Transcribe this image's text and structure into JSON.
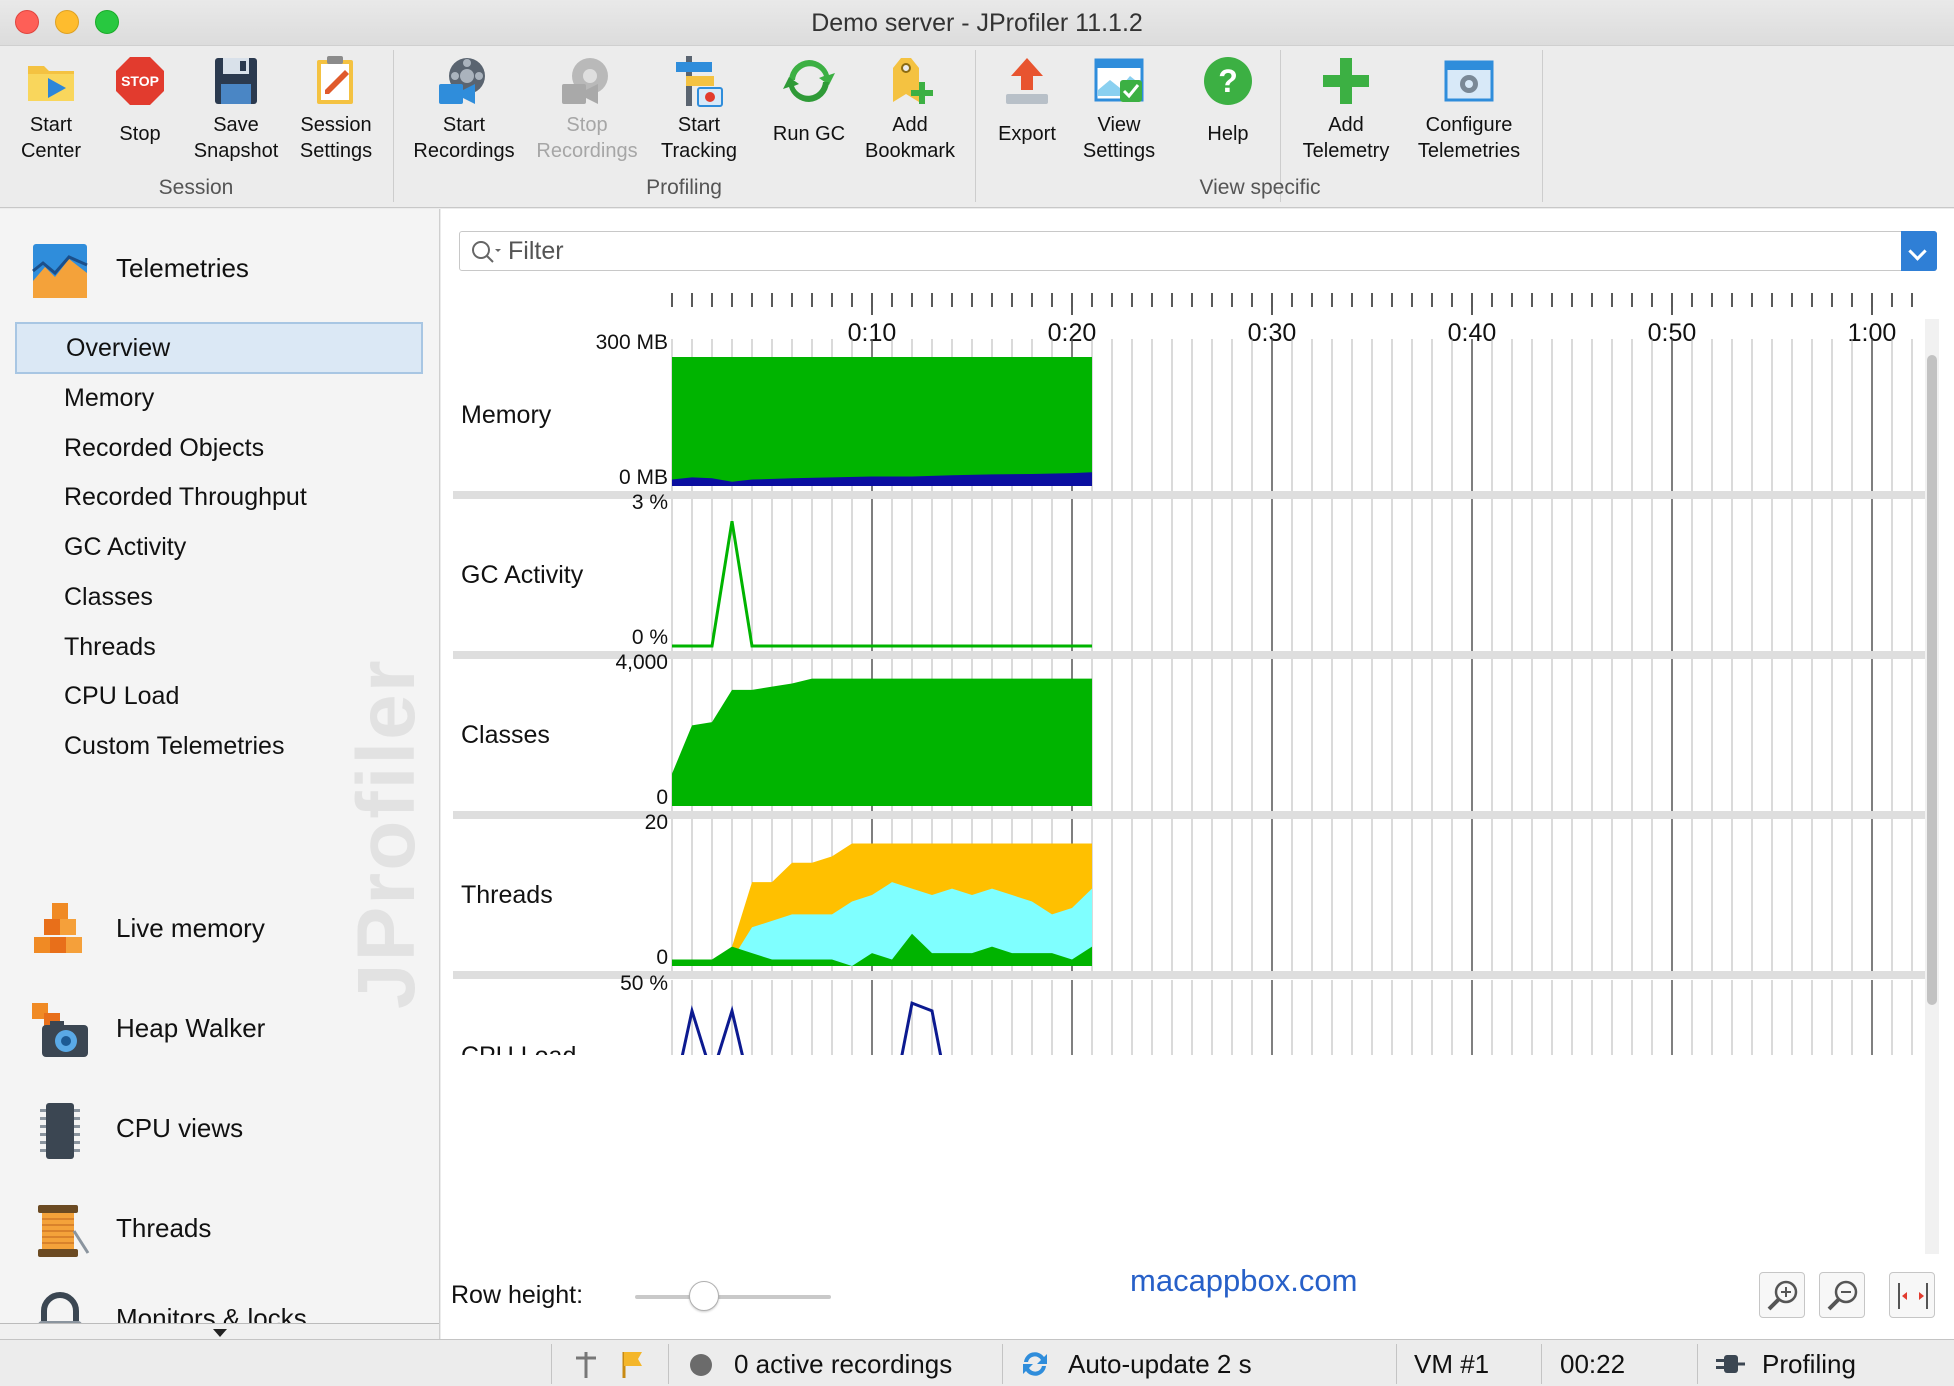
{
  "window": {
    "title": "Demo server - JProfiler 11.1.2"
  },
  "toolbar": {
    "groups": {
      "session": "Session",
      "profiling": "Profiling",
      "view": "View specific"
    },
    "buttons": {
      "start_center": {
        "l1": "Start",
        "l2": "Center"
      },
      "stop": {
        "l1": "Stop"
      },
      "save_snapshot": {
        "l1": "Save",
        "l2": "Snapshot"
      },
      "session_settings": {
        "l1": "Session",
        "l2": "Settings"
      },
      "start_recordings": {
        "l1": "Start",
        "l2": "Recordings"
      },
      "stop_recordings": {
        "l1": "Stop",
        "l2": "Recordings"
      },
      "start_tracking": {
        "l1": "Start",
        "l2": "Tracking"
      },
      "run_gc": {
        "l1": "Run GC"
      },
      "add_bookmark": {
        "l1": "Add",
        "l2": "Bookmark"
      },
      "export": {
        "l1": "Export"
      },
      "view_settings": {
        "l1": "View",
        "l2": "Settings"
      },
      "help": {
        "l1": "Help"
      },
      "add_telemetry": {
        "l1": "Add",
        "l2": "Telemetry"
      },
      "configure_telemetries": {
        "l1": "Configure",
        "l2": "Telemetries"
      }
    },
    "stop_icon_text": "STOP"
  },
  "sidebar": {
    "telemetries": "Telemetries",
    "items": [
      "Overview",
      "Memory",
      "Recorded Objects",
      "Recorded Throughput",
      "GC Activity",
      "Classes",
      "Threads",
      "CPU Load",
      "Custom Telemetries"
    ],
    "sections": [
      "Live memory",
      "Heap Walker",
      "CPU views",
      "Threads",
      "Monitors & locks"
    ],
    "watermark": "JProfiler"
  },
  "filter": {
    "placeholder": "Filter"
  },
  "bottom": {
    "row_height_label": "Row height:",
    "row_height_value": 0.35,
    "site": "macappbox.com"
  },
  "status": {
    "recordings": "0 active recordings",
    "autoupdate": "Auto-update 2 s",
    "vm": "VM #1",
    "time": "00:22",
    "mode": "Profiling"
  },
  "colors": {
    "green": "#00b400",
    "navy": "#0b0fa0",
    "orange": "#ffc000",
    "cyan": "#7fffff",
    "line_navy": "#0c1a90",
    "accent": "#2f7fd6"
  },
  "chart_data": {
    "type": "area",
    "x_ticks": [
      "0:10",
      "0:20",
      "0:30",
      "0:40",
      "0:50",
      "1:00"
    ],
    "x_tick_seconds": [
      10,
      20,
      30,
      40,
      50,
      60
    ],
    "x_range_seconds": [
      0,
      62
    ],
    "panels": [
      {
        "name": "Memory",
        "ymax_label": "300 MB",
        "ymin_label": "0 MB",
        "ylim": [
          0,
          300
        ],
        "series": [
          {
            "color": "#00b400",
            "points": [
              [
                0,
                300
              ],
              [
                21,
                300
              ]
            ]
          },
          {
            "color": "#0b0fa0",
            "points": [
              [
                0,
                15
              ],
              [
                1,
                20
              ],
              [
                2,
                18
              ],
              [
                3,
                10
              ],
              [
                4,
                15
              ],
              [
                6,
                18
              ],
              [
                8,
                20
              ],
              [
                10,
                22
              ],
              [
                12,
                22
              ],
              [
                14,
                25
              ],
              [
                16,
                27
              ],
              [
                18,
                28
              ],
              [
                20,
                30
              ],
              [
                21,
                32
              ]
            ]
          }
        ]
      },
      {
        "name": "GC Activity",
        "ymax_label": "3 %",
        "ymin_label": "0 %",
        "ylim": [
          0,
          3
        ],
        "line": {
          "color": "#00b400",
          "points": [
            [
              0,
              0
            ],
            [
              2,
              0
            ],
            [
              3,
              2.9
            ],
            [
              4,
              0
            ],
            [
              21,
              0
            ]
          ]
        }
      },
      {
        "name": "Classes",
        "ymax_label": "4,000",
        "ymin_label": "0",
        "ylim": [
          0,
          4000
        ],
        "series": [
          {
            "color": "#00b400",
            "points": [
              [
                0,
                1000
              ],
              [
                1,
                2500
              ],
              [
                2,
                2600
              ],
              [
                3,
                3600
              ],
              [
                4,
                3600
              ],
              [
                5,
                3700
              ],
              [
                6,
                3800
              ],
              [
                7,
                3950
              ],
              [
                21,
                3950
              ]
            ]
          }
        ]
      },
      {
        "name": "Threads",
        "ymax_label": "20",
        "ymin_label": "0",
        "ylim": [
          0,
          20
        ],
        "series": [
          {
            "color": "#ffc000",
            "points": [
              [
                0,
                0
              ],
              [
                2,
                0
              ],
              [
                3,
                3
              ],
              [
                4,
                13
              ],
              [
                5,
                13
              ],
              [
                6,
                16
              ],
              [
                7,
                16
              ],
              [
                8,
                17
              ],
              [
                9,
                19
              ],
              [
                21,
                19
              ]
            ]
          },
          {
            "color": "#7fffff",
            "points": [
              [
                0,
                0
              ],
              [
                2,
                0
              ],
              [
                3,
                1
              ],
              [
                4,
                6
              ],
              [
                5,
                7
              ],
              [
                6,
                8
              ],
              [
                7,
                8
              ],
              [
                8,
                8
              ],
              [
                9,
                10
              ],
              [
                10,
                11
              ],
              [
                11,
                13
              ],
              [
                12,
                12
              ],
              [
                13,
                11
              ],
              [
                14,
                12
              ],
              [
                15,
                11
              ],
              [
                16,
                12
              ],
              [
                17,
                11
              ],
              [
                18,
                10
              ],
              [
                19,
                8
              ],
              [
                20,
                9
              ],
              [
                21,
                12
              ]
            ]
          },
          {
            "color": "#00b400",
            "points": [
              [
                0,
                1
              ],
              [
                2,
                1
              ],
              [
                3,
                3
              ],
              [
                4,
                2
              ],
              [
                5,
                1
              ],
              [
                6,
                1
              ],
              [
                7,
                1
              ],
              [
                8,
                1
              ],
              [
                9,
                0
              ],
              [
                10,
                2
              ],
              [
                11,
                1
              ],
              [
                12,
                5
              ],
              [
                13,
                2
              ],
              [
                14,
                2
              ],
              [
                15,
                2
              ],
              [
                16,
                3
              ],
              [
                17,
                2
              ],
              [
                18,
                2
              ],
              [
                19,
                2
              ],
              [
                20,
                1
              ],
              [
                21,
                3
              ]
            ]
          }
        ]
      },
      {
        "name": "CPU Load",
        "ymax_label": "50 %",
        "ymin_label": "",
        "ylim": [
          0,
          50
        ],
        "line": {
          "color": "#0c1a90",
          "points": [
            [
              0.3,
              20
            ],
            [
              1,
              45
            ],
            [
              2,
              20
            ],
            [
              3,
              45
            ],
            [
              4,
              12
            ],
            [
              5,
              5
            ],
            [
              6,
              8
            ],
            [
              11,
              8
            ],
            [
              12,
              48
            ],
            [
              13,
              45
            ],
            [
              14,
              5
            ]
          ]
        }
      }
    ]
  }
}
